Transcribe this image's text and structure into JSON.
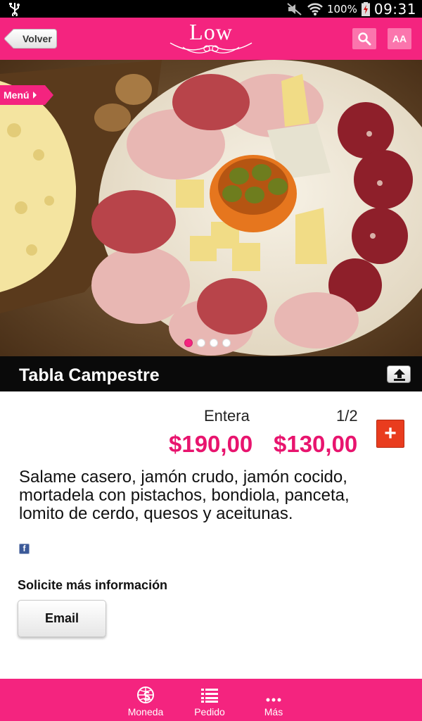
{
  "status_bar": {
    "battery": "100%",
    "time": "09:31",
    "icons": [
      "usb-icon",
      "mute-icon",
      "wifi-icon",
      "battery-icon"
    ]
  },
  "header": {
    "back_label": "Volver",
    "logo_text": "Low",
    "search_icon": "search-icon",
    "font_size_label": "AA"
  },
  "hero": {
    "menu_label": "Menú",
    "image_description_icon": "food-photo",
    "slide_count": 4,
    "active_slide": 1
  },
  "product": {
    "title": "Tabla Campestre",
    "prices": [
      {
        "label": "Entera",
        "value": "$190,00"
      },
      {
        "label": "1/2",
        "value": "$130,00"
      }
    ],
    "add_label": "+",
    "description": "Salame casero, jamón crudo, jamón cocido, mortadela con pistachos, bondiola, panceta, lomito de cerdo, quesos y aceitunas."
  },
  "contact": {
    "heading": "Solicite más información",
    "email_label": "Email"
  },
  "bottom_nav": [
    {
      "label": "Moneda",
      "icon": "currency-globe-icon"
    },
    {
      "label": "Pedido",
      "icon": "list-icon"
    },
    {
      "label": "Más",
      "icon": "more-icon"
    }
  ],
  "colors": {
    "brand_pink": "#f4247f",
    "price_pink": "#e8146e",
    "add_button": "#e93c1e",
    "title_bar": "#0a0a0a"
  }
}
